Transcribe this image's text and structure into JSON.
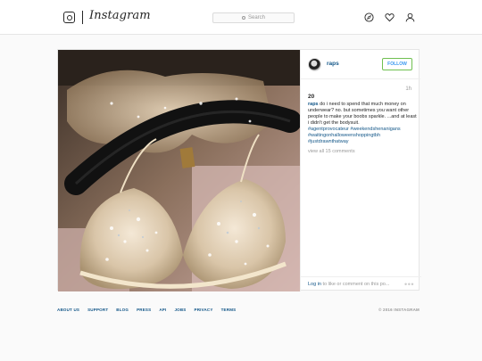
{
  "header": {
    "logo_text": "Instagram",
    "search_placeholder": "Search",
    "nav_icons": [
      "compass-icon",
      "heart-icon",
      "profile-icon"
    ]
  },
  "post": {
    "username": "raps",
    "follow_label": "FOLLOW",
    "likes": "20",
    "age": "1h",
    "caption_user": "raps",
    "caption_text": "do i need to spend that much money on underwear? no. but sometimes you want other people to make your boobs sparkle. ...and at least i didn't get the bodysuit.",
    "hashtags": [
      "#agentprovocateur #weekendshenanigans",
      "#waitingonhalloweenshoppingtbh",
      "#justdrawnthatway"
    ],
    "view_comments": "view all 15 comments",
    "login_link": "Log in",
    "login_text": " to like or comment on this po...",
    "more_label": "•••"
  },
  "footer": {
    "links": [
      "ABOUT US",
      "SUPPORT",
      "BLOG",
      "PRESS",
      "API",
      "JOBS",
      "PRIVACY",
      "TERMS"
    ],
    "copyright": "© 2016 INSTAGRAM"
  },
  "colors": {
    "link": "#125688",
    "follow_border": "#70c050",
    "follow_text": "#3897f0",
    "background": "#fafafa"
  }
}
